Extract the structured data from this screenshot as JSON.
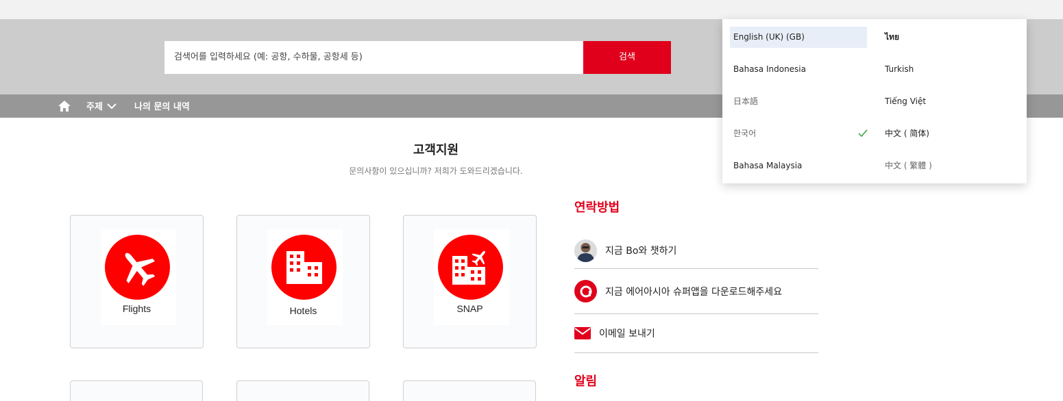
{
  "search": {
    "placeholder": "검색어를 입력하세요 (예: 공항, 수하물, 공항세 등)",
    "button_label": "검색"
  },
  "nav": {
    "topic_label": "주제",
    "history_label": "나의 문의 내역"
  },
  "main": {
    "title": "고객지원",
    "subtitle": "문의사항이 있으십니까? 저희가 도와드리겠습니다."
  },
  "cards": [
    {
      "label": "Flights",
      "icon": "airplane-icon"
    },
    {
      "label": "Hotels",
      "icon": "hotel-buildings-icon"
    },
    {
      "label": "SNAP",
      "icon": "snap-hotel-flight-icon"
    }
  ],
  "contact": {
    "title": "연락방법",
    "items": [
      {
        "label": "지금 Bo와 챗하기",
        "icon": "bo-avatar"
      },
      {
        "label": "지금 에어아시아 슈퍼앱을 다운로드해주세요",
        "icon": "airasia-app-icon"
      },
      {
        "label": "이메일 보내기",
        "icon": "email-icon"
      }
    ]
  },
  "notice": {
    "title": "알림"
  },
  "languages": {
    "left": [
      "English (UK) (GB)",
      "Bahasa Indonesia",
      "日本語",
      "한국어",
      "Bahasa Malaysia"
    ],
    "right": [
      "ไทย",
      "Turkish",
      "Tiếng Việt",
      "中文 ( 简体)",
      "中文 ( 繁體 )"
    ],
    "highlighted": "English (UK) (GB)",
    "selected": "한국어"
  },
  "colors": {
    "brand_red": "#e0001b",
    "icon_red": "#ff0000",
    "nav_gray": "#979797",
    "band_gray": "#cccccc",
    "check_green": "#4caf50"
  }
}
